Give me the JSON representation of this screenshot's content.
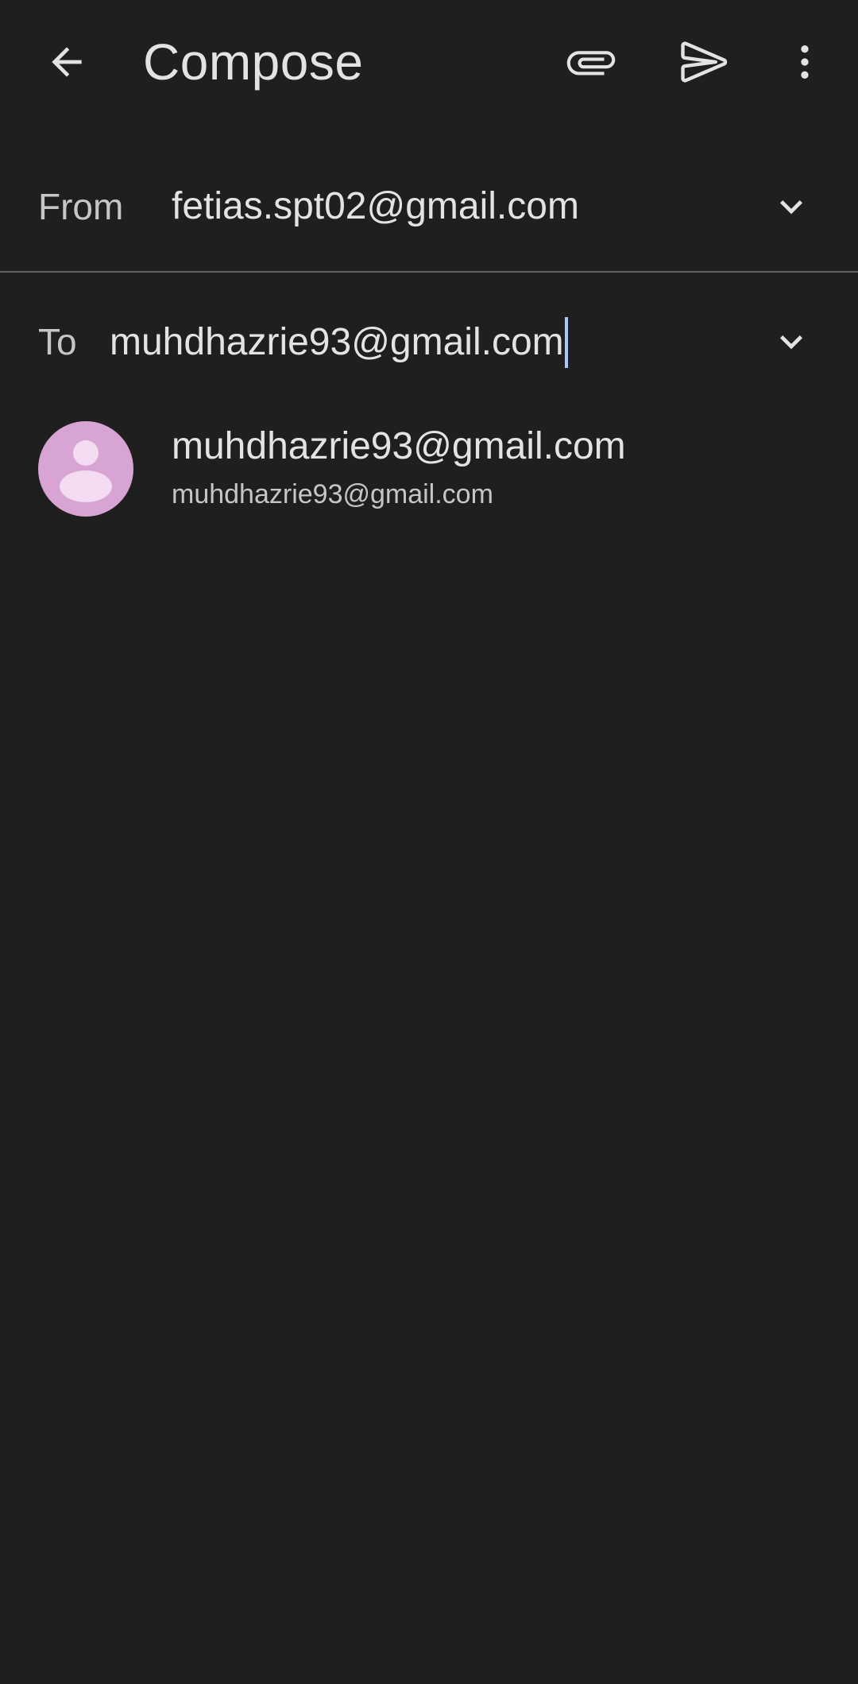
{
  "header": {
    "title": "Compose",
    "back_icon": "arrow-back-icon",
    "attach_icon": "paperclip-icon",
    "send_icon": "send-icon",
    "more_icon": "more-vert-icon"
  },
  "from": {
    "label": "From",
    "value": "fetias.spt02@gmail.com",
    "expand_icon": "chevron-down-icon"
  },
  "to": {
    "label": "To",
    "value": "muhdhazrie93@gmail.com",
    "expand_icon": "chevron-down-icon"
  },
  "suggestion": {
    "name": "muhdhazrie93@gmail.com",
    "email": "muhdhazrie93@gmail.com",
    "avatar_icon": "person-avatar-icon"
  },
  "colors": {
    "background": "#1f1f1f",
    "text_primary": "#e3e3e3",
    "text_secondary": "#c4c7c5",
    "divider": "#5f6368",
    "caret": "#a8c7fa",
    "avatar_bg": "#d8a4d4"
  }
}
